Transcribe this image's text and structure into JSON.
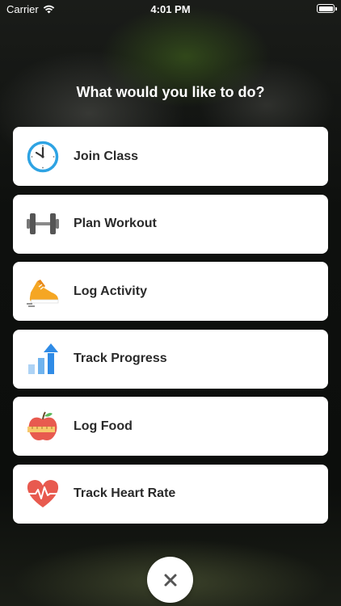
{
  "status_bar": {
    "carrier": "Carrier",
    "time": "4:01 PM"
  },
  "heading": "What would you like to do?",
  "menu": {
    "items": [
      {
        "label": "Join Class",
        "icon": "clock-icon"
      },
      {
        "label": "Plan Workout",
        "icon": "dumbbell-icon"
      },
      {
        "label": "Log Activity",
        "icon": "sneaker-icon"
      },
      {
        "label": "Track Progress",
        "icon": "progress-chart-icon"
      },
      {
        "label": "Log Food",
        "icon": "apple-icon"
      },
      {
        "label": "Track Heart Rate",
        "icon": "heart-rate-icon"
      }
    ]
  },
  "close_button": {
    "icon": "close-icon"
  },
  "colors": {
    "accent_blue": "#2ea3e3",
    "orange": "#f5a623",
    "red": "#e85a4f",
    "text": "#2a2a2a"
  }
}
